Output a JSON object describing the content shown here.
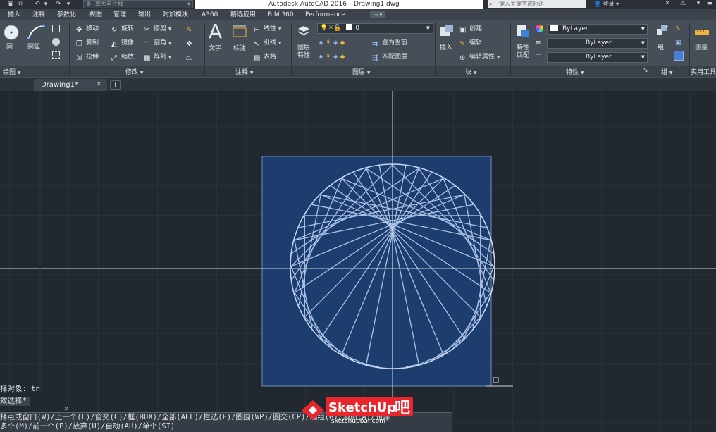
{
  "titlebar": {
    "workspace_placeholder": "草图与注释",
    "app_name": "Autodesk AutoCAD 2016",
    "filename": "Drawing1.dwg",
    "search_placeholder": "键入关键字或短语",
    "login_label": "登录"
  },
  "tabs": [
    {
      "label": "插入"
    },
    {
      "label": "注释"
    },
    {
      "label": "参数化"
    },
    {
      "label": "视图"
    },
    {
      "label": "管理"
    },
    {
      "label": "输出"
    },
    {
      "label": "附加模块"
    },
    {
      "label": "A360"
    },
    {
      "label": "精选应用"
    },
    {
      "label": "BIM 360"
    },
    {
      "label": "Performance"
    }
  ],
  "ribbon": {
    "draw": {
      "circle": "圆",
      "arc": "圆弧",
      "panel": "绘图"
    },
    "modify": {
      "move": "移动",
      "rotate": "旋转",
      "trim": "修剪",
      "copy": "复制",
      "mirror": "镜像",
      "fillet": "圆角",
      "stretch": "拉伸",
      "scale": "缩放",
      "array": "阵列",
      "panel": "修改"
    },
    "annotation": {
      "text": "文字",
      "dimension": "标注",
      "linear": "线性",
      "leader": "引线",
      "table": "表格",
      "panel": "注释"
    },
    "layers": {
      "layer_props": "图层\n特性",
      "layer_value": "0",
      "set_current": "置为当前",
      "match_layer": "匹配图层",
      "panel": "图层"
    },
    "block": {
      "insert": "插入",
      "create": "创建",
      "edit": "编辑",
      "edit_attr": "编辑属性",
      "panel": "块"
    },
    "properties": {
      "match": "特性\n匹配",
      "color": "ByLayer",
      "linetype": "ByLayer",
      "lineweight": "ByLayer",
      "panel": "特性"
    },
    "groups": {
      "group": "组",
      "panel": "组"
    },
    "utilities": {
      "measure": "测量",
      "panel": "实用工具"
    }
  },
  "doc_tab": {
    "label": "Drawing1*"
  },
  "command": {
    "line1": "择对象: tn",
    "line2": "效选择*",
    "prompt1": "择点或窗口(W)/上一个(L)/窗交(C)/框(BOX)/全部(ALL)/栏选(F)/圈围(WP)/圈交(CP)/编组(G)/添加(A)/删除",
    "prompt2": "多个(M)/前一个(P)/放弃(U)/自动(AU)/单个(SI)"
  },
  "watermark": {
    "brand": "SketchUp",
    "suffix": "吧",
    "url": "sketchupbar.com"
  },
  "colors": {
    "background": "#212830",
    "ribbon": "#464e58",
    "selection": "#1c3d6e",
    "curve": "#b9cdf0"
  }
}
